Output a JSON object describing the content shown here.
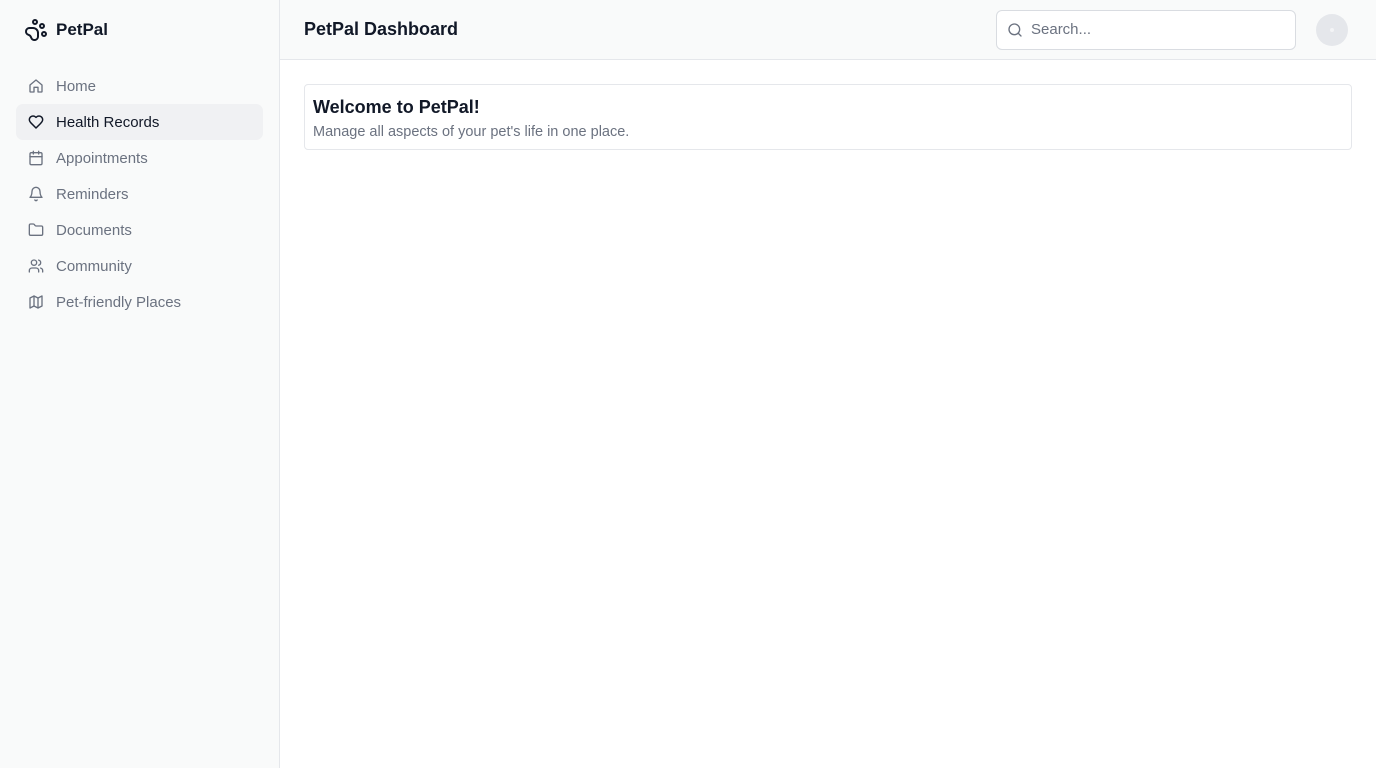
{
  "brand": {
    "name": "PetPal",
    "icon": "paw-icon"
  },
  "sidebar": {
    "items": [
      {
        "label": "Home",
        "icon": "home-icon",
        "active": false
      },
      {
        "label": "Health Records",
        "icon": "heart-icon",
        "active": true
      },
      {
        "label": "Appointments",
        "icon": "calendar-icon",
        "active": false
      },
      {
        "label": "Reminders",
        "icon": "bell-icon",
        "active": false
      },
      {
        "label": "Documents",
        "icon": "folder-icon",
        "active": false
      },
      {
        "label": "Community",
        "icon": "users-icon",
        "active": false
      },
      {
        "label": "Pet-friendly Places",
        "icon": "map-icon",
        "active": false
      }
    ]
  },
  "header": {
    "title": "PetPal Dashboard",
    "search": {
      "placeholder": "Search...",
      "value": ""
    }
  },
  "welcome": {
    "title": "Welcome to PetPal!",
    "text": "Manage all aspects of your pet's life in one place."
  },
  "colors": {
    "sidebar_bg": "#f9fafa",
    "active_item_bg": "#f0f1f3",
    "muted_text": "#6b7280",
    "border": "#e5e7eb"
  }
}
